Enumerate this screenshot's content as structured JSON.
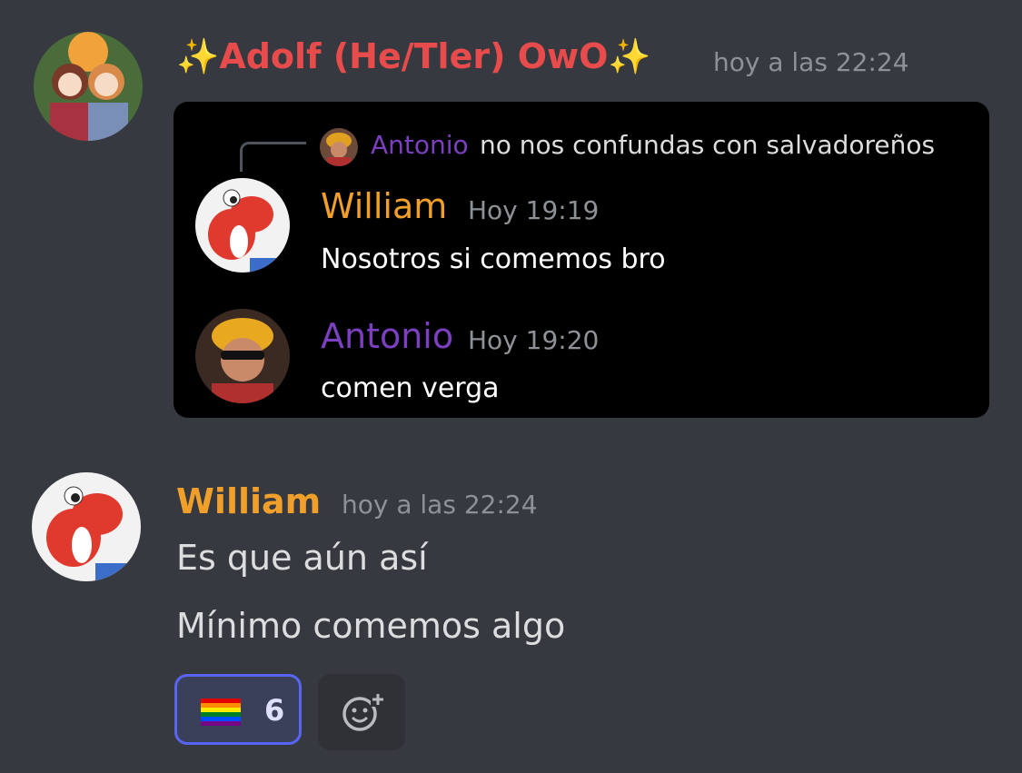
{
  "message1": {
    "author": "✨Adolf (He/Tler) OwO✨",
    "timestamp": "hoy a las 22:24",
    "avatar": "avatar-two-girls",
    "embed": {
      "reply": {
        "author": "Antonio",
        "text": "no nos confundas con salvadoreños"
      },
      "messages": [
        {
          "author": "William",
          "timestamp": "Hoy 19:19",
          "text": "Nosotros si comemos bro",
          "name_color": "#f0a02a"
        },
        {
          "author": "Antonio",
          "timestamp": "Hoy 19:20",
          "text": "comen verga",
          "name_color": "#7b3fbf"
        }
      ]
    }
  },
  "message2": {
    "author": "William",
    "timestamp": "hoy a las 22:24",
    "lines": [
      "Es que aún así",
      "Mínimo comemos algo"
    ],
    "reactions": [
      {
        "emoji": "rainbow-flag",
        "count": "6",
        "selected": true
      }
    ],
    "add_reaction_icon": "add-reaction-icon"
  },
  "colors": {
    "background": "#36393f",
    "accent": "#5865f2",
    "author1": "#e84b4b",
    "author2": "#f0a02a"
  }
}
